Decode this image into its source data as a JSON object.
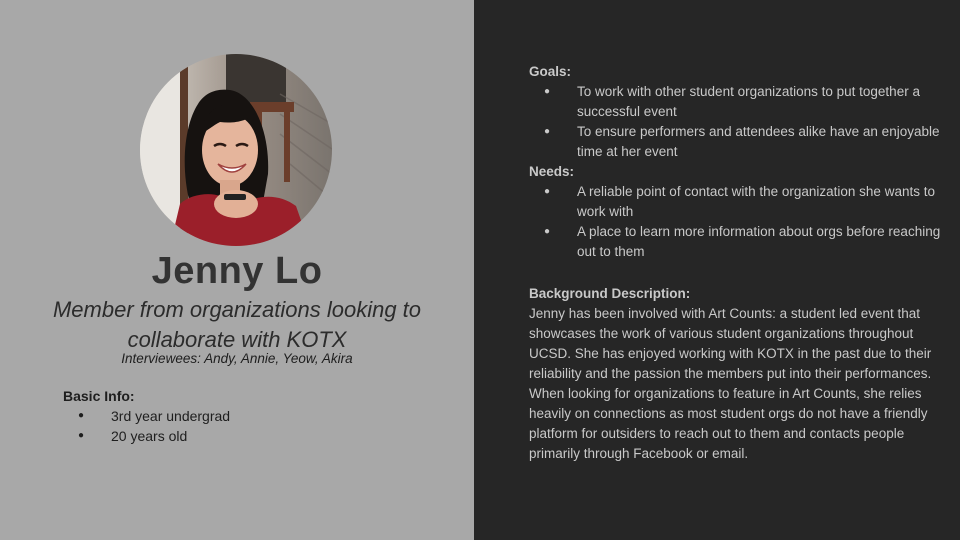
{
  "profile": {
    "name": "Jenny Lo",
    "role": "Member from organizations looking to collaborate with KOTX",
    "interviewees": "Interviewees: Andy, Annie, Yeow, Akira"
  },
  "basic_info": {
    "heading": "Basic Info:",
    "items": [
      "3rd year undergrad",
      "20 years old"
    ]
  },
  "goals": {
    "heading": "Goals:",
    "items": [
      "To work with other student organizations to put together a successful event",
      "To ensure performers and attendees alike have an enjoyable time at her event"
    ]
  },
  "needs": {
    "heading": "Needs:",
    "items": [
      "A reliable point of contact with the organization she wants to work with",
      "A place to learn more information about orgs before reaching out to them"
    ]
  },
  "background": {
    "heading": "Background Description:",
    "text": "Jenny has been involved with Art Counts: a student led event that showcases the work of various student organizations throughout UCSD. She has enjoyed working with KOTX in the past due to their reliability and the passion the members put into their performances. When looking for organizations to feature in Art Counts, she relies heavily on connections as most student orgs do not have a friendly platform for outsiders to reach out to them and contacts people primarily through Facebook or email."
  },
  "bullet_glyph": "●",
  "colors": {
    "left_bg": "#a8a8a8",
    "right_bg": "#262626",
    "right_text": "#c9c9c9",
    "shirt": "#9b1f2a"
  },
  "icons": {
    "avatar": "profile-photo"
  }
}
